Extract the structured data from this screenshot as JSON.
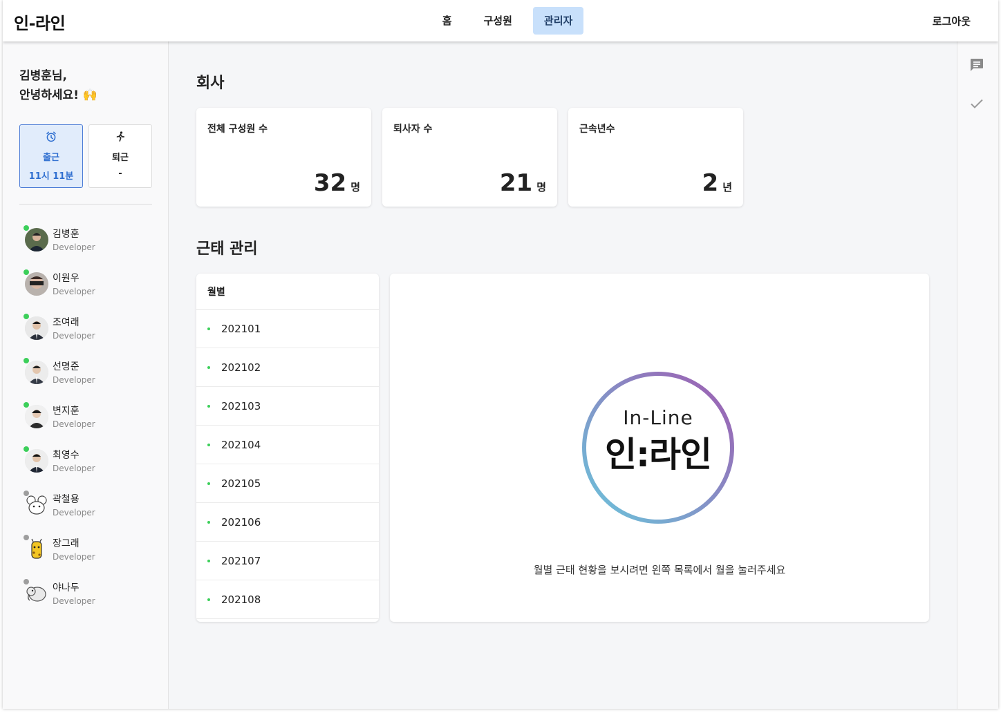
{
  "header": {
    "brand": "인-라인",
    "nav": [
      {
        "label": "홈"
      },
      {
        "label": "구성원"
      },
      {
        "label": "관리자"
      }
    ],
    "logout_label": "로그아웃"
  },
  "sidebar": {
    "greeting_line1": "김병훈님,",
    "greeting_line2": "안녕하세요! 🙌",
    "clock_in": {
      "label": "출근",
      "time": "11시 11분",
      "icon": "alarm-clock-icon"
    },
    "clock_out": {
      "label": "퇴근",
      "time": "-",
      "icon": "running-person-icon"
    },
    "members": [
      {
        "name": "김병훈",
        "role": "Developer",
        "online": true
      },
      {
        "name": "이원우",
        "role": "Developer",
        "online": true
      },
      {
        "name": "조여래",
        "role": "Developer",
        "online": true
      },
      {
        "name": "선명준",
        "role": "Developer",
        "online": true
      },
      {
        "name": "변지훈",
        "role": "Developer",
        "online": true
      },
      {
        "name": "최영수",
        "role": "Developer",
        "online": true
      },
      {
        "name": "곽철용",
        "role": "Developer",
        "online": false
      },
      {
        "name": "장그래",
        "role": "Developer",
        "online": false
      },
      {
        "name": "야나두",
        "role": "Developer",
        "online": false
      }
    ]
  },
  "company": {
    "title": "회사",
    "stats": [
      {
        "label": "전체 구성원 수",
        "value": "32",
        "unit": "명"
      },
      {
        "label": "퇴사자 수",
        "value": "21",
        "unit": "명"
      },
      {
        "label": "근속년수",
        "value": "2",
        "unit": "년"
      }
    ]
  },
  "attendance": {
    "title": "근태 관리",
    "month_header": "월별",
    "months": [
      "202101",
      "202102",
      "202103",
      "202104",
      "202105",
      "202106",
      "202107",
      "202108"
    ],
    "logo_en": "In-Line",
    "logo_ko": "인:라인",
    "hint": "월별 근태 현황을 보시려면 왼쪽 목록에서 월을 눌러주세요"
  },
  "rail": {
    "icons": [
      "chat-icon",
      "check-icon"
    ]
  },
  "colors": {
    "accent": "#c8e0fb",
    "online": "#3ccf5a",
    "offline": "#9e9e9e",
    "logo_gradient_top": "#a05ab0",
    "logo_gradient_bottom": "#6ac6dc"
  }
}
